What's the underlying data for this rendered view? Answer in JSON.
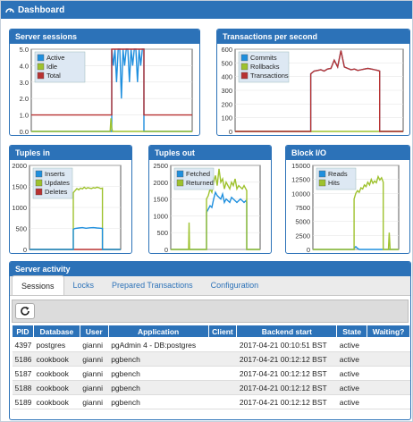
{
  "header": {
    "title": "Dashboard"
  },
  "colors": {
    "accent": "#2c72b8",
    "active": "#1f8fde",
    "idle": "#9ec22d",
    "total": "#b83232",
    "plot_bg": "#ffffff"
  },
  "charts": {
    "sessions": {
      "title": "Server sessions",
      "legend": [
        "Active",
        "Idle",
        "Total"
      ]
    },
    "tps": {
      "title": "Transactions per second",
      "legend": [
        "Commits",
        "Rollbacks",
        "Transactions"
      ]
    },
    "tuples_in": {
      "title": "Tuples in",
      "legend": [
        "Inserts",
        "Updates",
        "Deletes"
      ]
    },
    "tuples_out": {
      "title": "Tuples out",
      "legend": [
        "Fetched",
        "Returned"
      ]
    },
    "block_io": {
      "title": "Block I/O",
      "legend": [
        "Reads",
        "Hits"
      ]
    }
  },
  "chart_data": [
    {
      "type": "line",
      "title": "Server sessions",
      "yticks": [
        "5.0",
        "4.0",
        "3.0",
        "2.0",
        "1.0",
        "0.0"
      ],
      "ylim": [
        0,
        5
      ],
      "xlim": [
        0,
        100
      ],
      "series": [
        {
          "name": "Active",
          "x": [
            0,
            50,
            50,
            51,
            52,
            53,
            54,
            55,
            56,
            57,
            58,
            59,
            60,
            61,
            62,
            63,
            64,
            65,
            66,
            67,
            68,
            69,
            70,
            70,
            100
          ],
          "y": [
            0,
            0,
            5,
            4,
            5,
            3,
            5,
            5,
            2,
            5,
            4,
            5,
            5,
            3,
            5,
            4,
            5,
            5,
            3,
            5,
            4,
            5,
            5,
            0,
            0
          ]
        },
        {
          "name": "Idle",
          "x": [
            0,
            49,
            49.5,
            50,
            50.5,
            51,
            100
          ],
          "y": [
            0,
            0,
            0.8,
            0.2,
            0,
            0,
            0
          ]
        },
        {
          "name": "Total",
          "x": [
            0,
            50,
            50,
            70,
            70,
            100
          ],
          "y": [
            1,
            1,
            5,
            5,
            1,
            1
          ]
        }
      ]
    },
    {
      "type": "line",
      "title": "Transactions per second",
      "yticks": [
        "600",
        "500",
        "400",
        "300",
        "200",
        "100",
        "0"
      ],
      "ylim": [
        0,
        600
      ],
      "xlim": [
        0,
        100
      ],
      "series": [
        {
          "name": "Commits",
          "x": [
            0,
            45,
            45,
            47,
            49,
            51,
            53,
            55,
            57,
            59,
            61,
            63,
            65,
            67,
            69,
            71,
            73,
            75,
            77,
            79,
            81,
            83,
            85,
            86,
            86,
            100
          ],
          "y": [
            0,
            0,
            420,
            440,
            445,
            450,
            440,
            455,
            460,
            520,
            470,
            590,
            470,
            460,
            450,
            455,
            445,
            450,
            455,
            460,
            455,
            450,
            445,
            440,
            0,
            0
          ]
        },
        {
          "name": "Rollbacks",
          "x": [
            0,
            100
          ],
          "y": [
            0,
            0
          ]
        },
        {
          "name": "Transactions",
          "x": [
            0,
            45,
            45,
            47,
            49,
            51,
            53,
            55,
            57,
            59,
            61,
            63,
            65,
            67,
            69,
            71,
            73,
            75,
            77,
            79,
            81,
            83,
            85,
            86,
            86,
            100
          ],
          "y": [
            0,
            0,
            420,
            440,
            445,
            450,
            440,
            455,
            460,
            520,
            470,
            590,
            470,
            460,
            450,
            455,
            445,
            450,
            455,
            460,
            455,
            450,
            445,
            440,
            0,
            0
          ]
        }
      ]
    },
    {
      "type": "line",
      "title": "Tuples in",
      "yticks": [
        "2000",
        "1500",
        "1000",
        "500",
        "0"
      ],
      "ylim": [
        0,
        2000
      ],
      "xlim": [
        0,
        100
      ],
      "series": [
        {
          "name": "Inserts",
          "x": [
            0,
            48,
            48,
            60,
            80,
            80,
            100
          ],
          "y": [
            0,
            0,
            0,
            0,
            0,
            0,
            0
          ]
        },
        {
          "name": "Updates",
          "x": [
            0,
            48,
            48,
            50,
            52,
            54,
            56,
            58,
            60,
            62,
            64,
            66,
            68,
            70,
            72,
            74,
            76,
            78,
            80,
            80,
            100
          ],
          "y": [
            0,
            0,
            1350,
            1400,
            1450,
            1420,
            1460,
            1440,
            1480,
            1450,
            1470,
            1460,
            1450,
            1470,
            1460,
            1480,
            1470,
            1450,
            1460,
            0,
            0
          ]
        },
        {
          "name": "Deletes",
          "x": [
            0,
            48,
            48,
            50,
            54,
            58,
            62,
            66,
            70,
            74,
            78,
            80,
            80,
            100
          ],
          "y": [
            0,
            0,
            480,
            500,
            510,
            520,
            505,
            515,
            520,
            510,
            505,
            500,
            0,
            0
          ]
        }
      ]
    },
    {
      "type": "line",
      "title": "Tuples out",
      "yticks": [
        "2500",
        "2000",
        "1500",
        "1000",
        "500",
        "0"
      ],
      "ylim": [
        0,
        2500
      ],
      "xlim": [
        0,
        100
      ],
      "series": [
        {
          "name": "Fetched",
          "x": [
            0,
            40,
            40,
            42,
            44,
            46,
            48,
            50,
            52,
            54,
            56,
            58,
            60,
            62,
            64,
            66,
            68,
            70,
            72,
            74,
            76,
            78,
            80,
            82,
            84,
            85,
            85,
            100
          ],
          "y": [
            0,
            0,
            1100,
            1200,
            1300,
            1250,
            1500,
            1700,
            1600,
            1550,
            1500,
            1650,
            1400,
            1500,
            1450,
            1400,
            1550,
            1500,
            1450,
            1400,
            1450,
            1500,
            1450,
            1400,
            1450,
            1400,
            0,
            0
          ]
        },
        {
          "name": "Returned",
          "x": [
            0,
            20,
            20.5,
            21,
            40,
            40,
            42,
            44,
            46,
            48,
            50,
            52,
            54,
            56,
            58,
            60,
            62,
            64,
            66,
            68,
            70,
            72,
            74,
            76,
            78,
            80,
            82,
            84,
            85,
            85,
            100
          ],
          "y": [
            0,
            0,
            800,
            0,
            0,
            1500,
            1600,
            1800,
            1700,
            2000,
            2200,
            1900,
            2400,
            2000,
            2100,
            1800,
            2000,
            1900,
            1800,
            2000,
            1900,
            2100,
            1800,
            1900,
            1850,
            1800,
            1900,
            1800,
            1750,
            0,
            0
          ]
        }
      ]
    },
    {
      "type": "line",
      "title": "Block I/O",
      "yticks": [
        "15000",
        "12500",
        "10000",
        "7500",
        "5000",
        "2500",
        "0"
      ],
      "ylim": [
        0,
        15000
      ],
      "xlim": [
        0,
        100
      ],
      "series": [
        {
          "name": "Reads",
          "x": [
            0,
            48,
            48,
            50,
            52,
            54,
            100
          ],
          "y": [
            0,
            0,
            200,
            500,
            200,
            0,
            0
          ]
        },
        {
          "name": "Hits",
          "x": [
            0,
            48,
            48,
            50,
            52,
            54,
            56,
            58,
            60,
            62,
            64,
            66,
            68,
            70,
            72,
            74,
            76,
            78,
            80,
            82,
            82,
            88,
            89,
            90,
            100
          ],
          "y": [
            0,
            0,
            9000,
            10000,
            10500,
            10200,
            11000,
            10800,
            11500,
            11200,
            12000,
            11500,
            12500,
            11800,
            12200,
            11900,
            13000,
            12400,
            12800,
            12000,
            0,
            0,
            3000,
            0,
            0
          ]
        }
      ]
    }
  ],
  "activity": {
    "title": "Server activity",
    "tabs": [
      "Sessions",
      "Locks",
      "Prepared Transactions",
      "Configuration"
    ],
    "columns": [
      "PID",
      "Database",
      "User",
      "Application",
      "Client",
      "Backend start",
      "State",
      "Waiting?"
    ],
    "rows": [
      [
        "4397",
        "postgres",
        "gianni",
        "pgAdmin 4 - DB:postgres",
        "",
        "2017-04-21 00:10:51 BST",
        "active",
        ""
      ],
      [
        "5186",
        "cookbook",
        "gianni",
        "pgbench",
        "",
        "2017-04-21 00:12:12 BST",
        "active",
        ""
      ],
      [
        "5187",
        "cookbook",
        "gianni",
        "pgbench",
        "",
        "2017-04-21 00:12:12 BST",
        "active",
        ""
      ],
      [
        "5188",
        "cookbook",
        "gianni",
        "pgbench",
        "",
        "2017-04-21 00:12:12 BST",
        "active",
        ""
      ],
      [
        "5189",
        "cookbook",
        "gianni",
        "pgbench",
        "",
        "2017-04-21 00:12:12 BST",
        "active",
        ""
      ]
    ]
  }
}
